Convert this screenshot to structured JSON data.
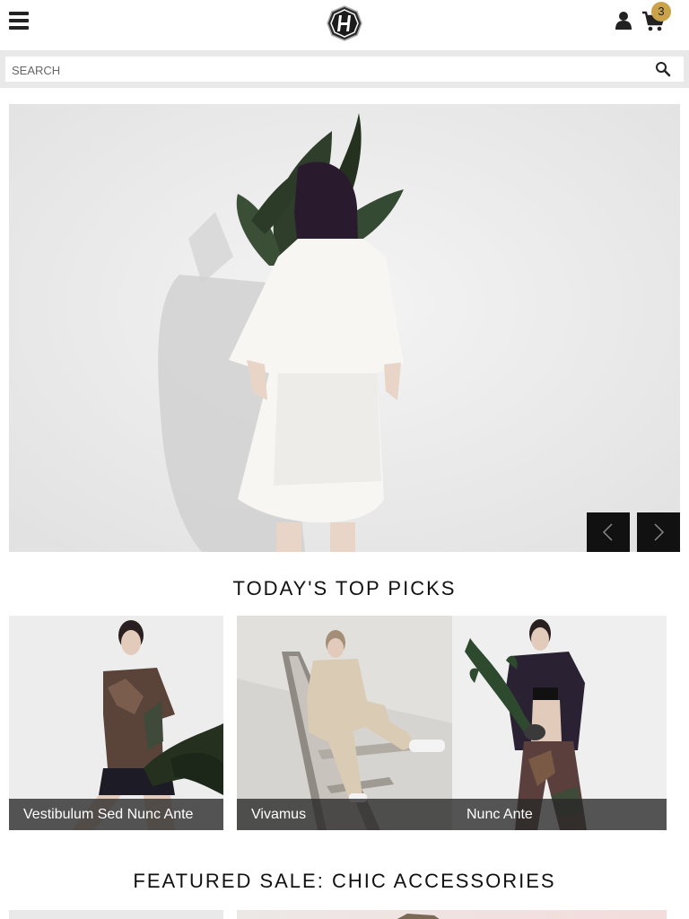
{
  "header": {
    "menu_icon": "hamburger-menu-icon",
    "logo_icon": "brand-logo-icon",
    "user_icon": "user-icon",
    "cart_icon": "cart-icon",
    "cart_count": "3",
    "accent_color": "#c9a24a"
  },
  "search": {
    "placeholder": "SEARCH",
    "icon": "search-icon"
  },
  "hero": {
    "prev_icon": "chevron-left-icon",
    "next_icon": "chevron-right-icon"
  },
  "top_picks": {
    "title": "Today's Top Picks",
    "items": [
      {
        "label": "Vestibulum Sed Nunc Ante"
      },
      {
        "label": "Vivamus"
      },
      {
        "label": "Nunc Ante"
      }
    ]
  },
  "featured": {
    "title": "Featured Sale: Chic Accessories"
  }
}
